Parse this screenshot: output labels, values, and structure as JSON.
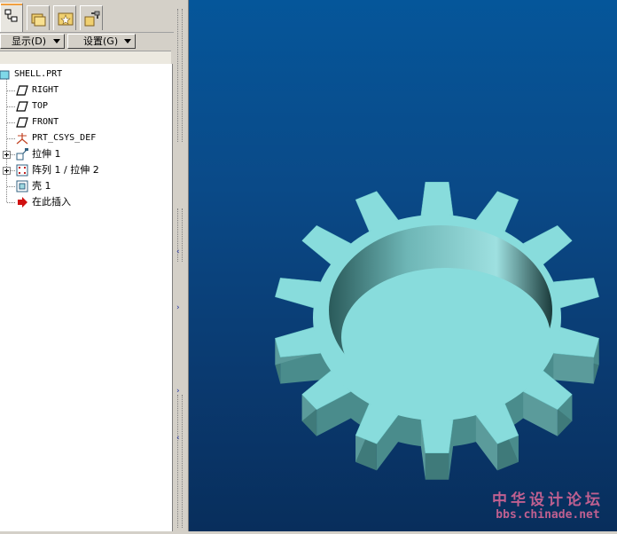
{
  "toolbar": {
    "show_label": "显示(D)",
    "settings_label": "设置(G)"
  },
  "tree": {
    "root": "SHELL.PRT",
    "items": [
      {
        "label": "RIGHT",
        "icon": "datum-plane-icon"
      },
      {
        "label": "TOP",
        "icon": "datum-plane-icon"
      },
      {
        "label": "FRONT",
        "icon": "datum-plane-icon"
      },
      {
        "label": "PRT_CSYS_DEF",
        "icon": "coordinate-system-icon"
      },
      {
        "label": "拉伸 1",
        "icon": "extrude-icon"
      },
      {
        "label": "阵列 1 / 拉伸 2",
        "icon": "pattern-icon"
      },
      {
        "label": "壳 1",
        "icon": "shell-icon"
      },
      {
        "label": "在此插入",
        "icon": "insert-here-arrow-icon"
      }
    ]
  },
  "watermark": {
    "title": "中华设计论坛",
    "url": "bbs.chinade.net"
  },
  "colors": {
    "model_top": "#88dcdc",
    "model_side": "#4a8c8c",
    "viewport_top": "#05569a",
    "viewport_bottom": "#082e5c",
    "watermark": "#c06090"
  }
}
